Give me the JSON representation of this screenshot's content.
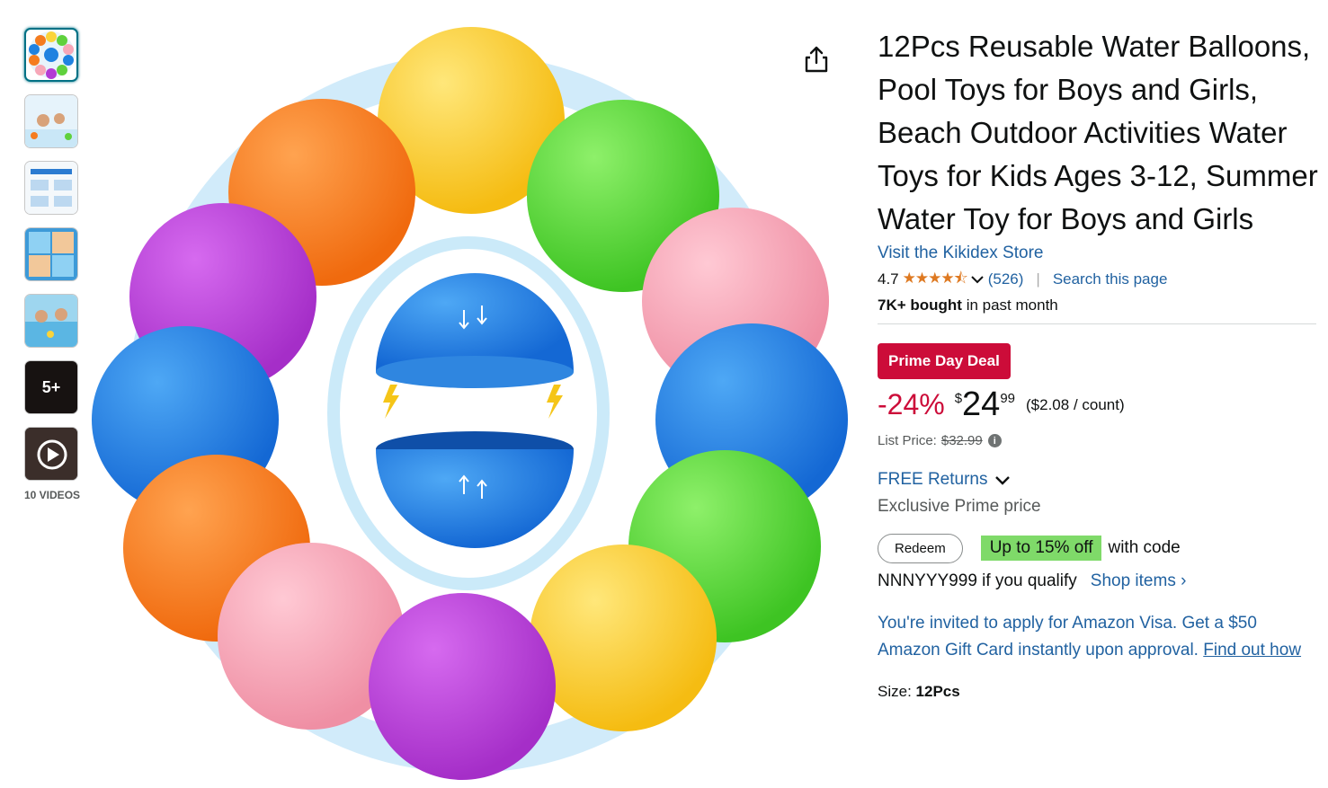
{
  "gallery": {
    "thumbnails": [
      {
        "name": "thumb-main"
      },
      {
        "name": "thumb-2"
      },
      {
        "name": "thumb-3"
      },
      {
        "name": "thumb-4"
      },
      {
        "name": "thumb-5"
      },
      {
        "name": "thumb-more",
        "overlay": "5+"
      },
      {
        "name": "thumb-video"
      }
    ],
    "videos_label": "10 VIDEOS",
    "share_icon": "share-icon"
  },
  "product": {
    "title": "12Pcs Reusable Water Balloons, Pool Toys for Boys and Girls, Beach Outdoor Activities Water Toys for Kids Ages 3-12, Summer Water Toy for Boys and Girls",
    "store_link": "Visit the Kikidex Store",
    "rating": "4.7",
    "stars": "★★★★⯪",
    "rating_count": "(526)",
    "search_page": "Search this page",
    "bought_bold": "7K+ bought",
    "bought_rest": " in past month"
  },
  "pricing": {
    "deal_badge": "Prime Day Deal",
    "discount": "-24%",
    "currency": "$",
    "whole": "24",
    "fraction": "99",
    "per_unit": "($2.08 / count)",
    "list_price_label": "List Price:",
    "list_price": "$32.99",
    "info_icon": "i"
  },
  "returns": {
    "label": "FREE Returns",
    "exclusive": "Exclusive Prime price"
  },
  "coupon": {
    "redeem": "Redeem",
    "upto": "Up to 15% off",
    "with_code": "with code",
    "code_text": "NNNYYY999 if you qualify",
    "shop_items": "Shop items ›"
  },
  "visa": {
    "text": "You're invited to apply for Amazon Visa. Get a $50 Amazon Gift Card instantly upon approval.",
    "link": "Find out how"
  },
  "size": {
    "label": "Size:",
    "value": "12Pcs"
  },
  "colors": {
    "link": "#2162a1",
    "deal": "#cc0c39",
    "coupon": "#7fda69",
    "star": "#de7921"
  }
}
